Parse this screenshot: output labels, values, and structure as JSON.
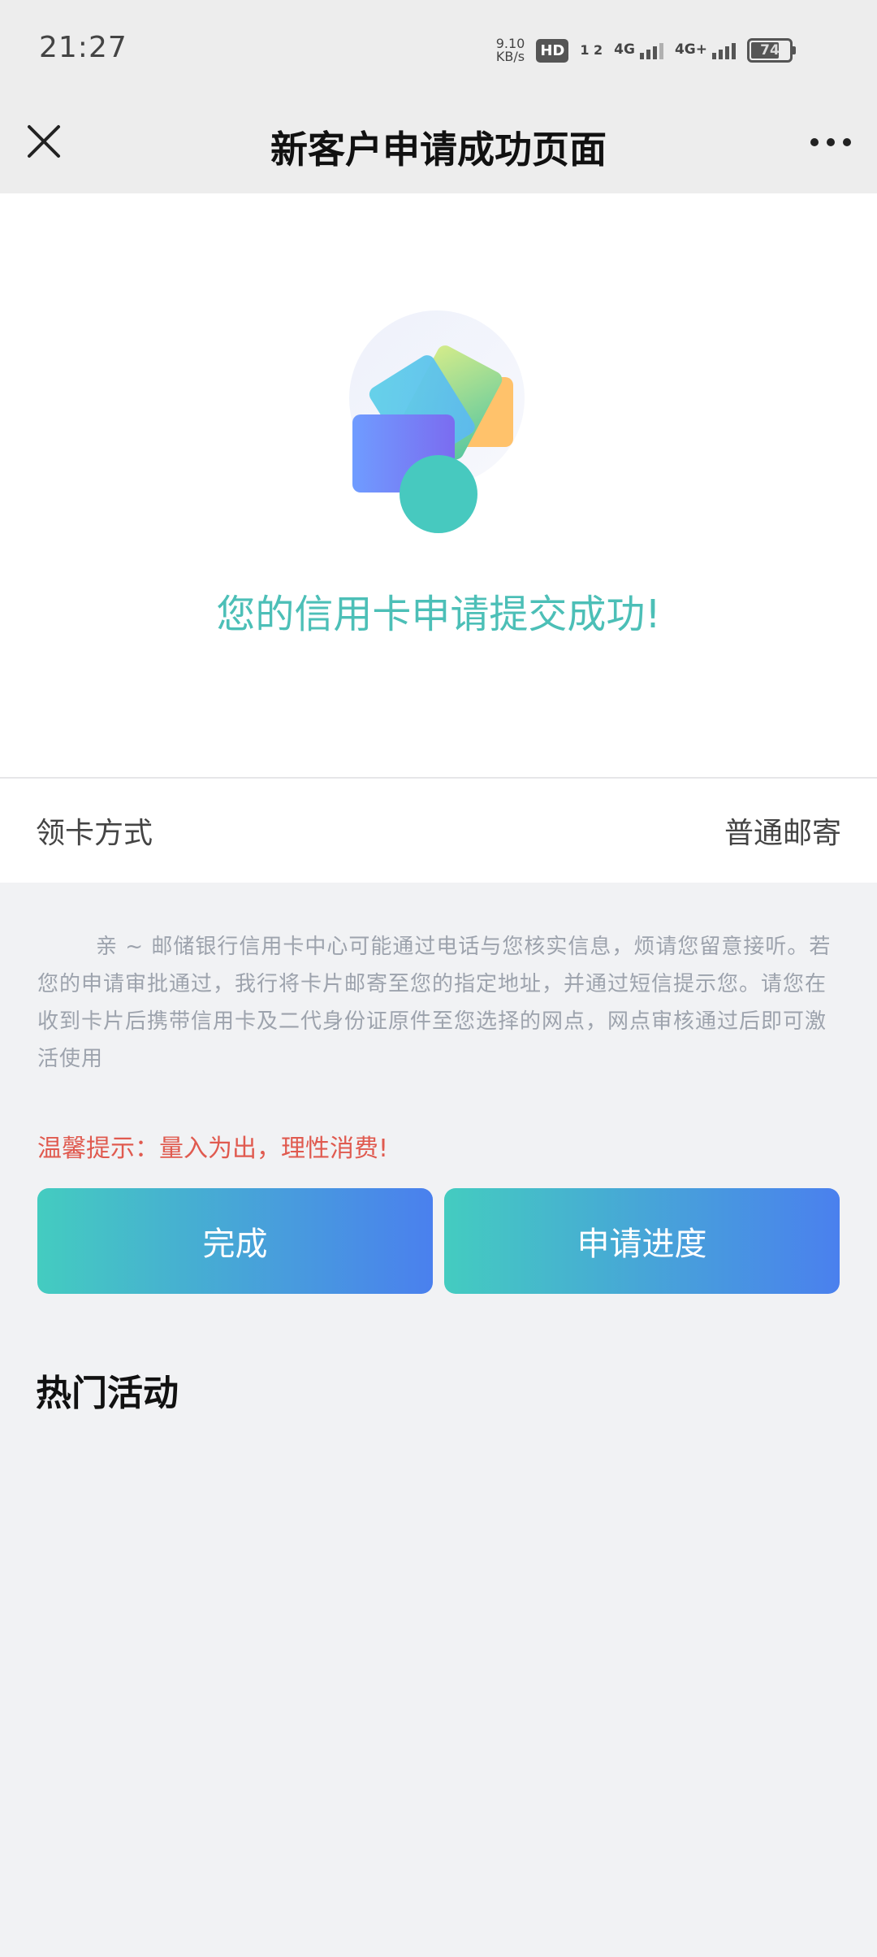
{
  "status_bar": {
    "time": "21:27",
    "net_speed_value": "9.10",
    "net_speed_unit": "KB/s",
    "hd_label": "HD",
    "sim_label": "1 2",
    "network1": "4G",
    "network2": "4G+",
    "battery": "74"
  },
  "nav": {
    "title": "新客户申请成功页面"
  },
  "success": {
    "message": "您的信用卡申请提交成功!"
  },
  "info_row": {
    "label": "领卡方式",
    "value": "普通邮寄"
  },
  "notice": "亲 ~ 邮储银行信用卡中心可能通过电话与您核实信息，烦请您留意接听。若您的申请审批通过，我行将卡片邮寄至您的指定地址，并通过短信提示您。请您在收到卡片后携带信用卡及二代身份证原件至您选择的网点，网点审核通过后即可激活使用",
  "warm_tip": "温馨提示：量入为出，理性消费!",
  "buttons": {
    "done": "完成",
    "progress": "申请进度"
  },
  "section": {
    "hot_activities": "热门活动"
  },
  "colors": {
    "accent": "#4cbfb7",
    "warning": "#e05a4f",
    "gradient_start": "#44ccc0",
    "gradient_end": "#4a80ee"
  }
}
